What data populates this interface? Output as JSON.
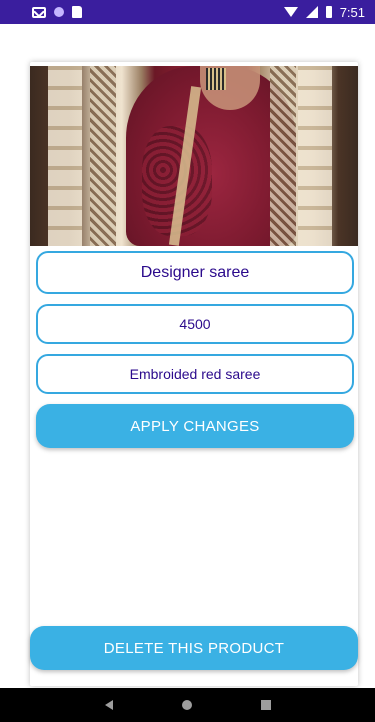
{
  "status_bar": {
    "time": "7:51",
    "left_icons": [
      "gmail-icon",
      "circle-icon",
      "sd-card-icon"
    ],
    "right_icons": [
      "wifi-icon",
      "signal-icon",
      "battery-icon"
    ],
    "color": "#3a1e9e"
  },
  "product": {
    "image_icon": "saree-photo",
    "name": "Designer saree",
    "price": "4500",
    "description": "Embroided red saree"
  },
  "actions": {
    "apply_label": "APPLY CHANGES",
    "delete_label": "DELETE THIS PRODUCT",
    "accent": "#3ab1e4",
    "border": "#35a8e0"
  },
  "nav_bar": {
    "icons": [
      "back-icon",
      "home-icon",
      "recents-icon"
    ]
  }
}
